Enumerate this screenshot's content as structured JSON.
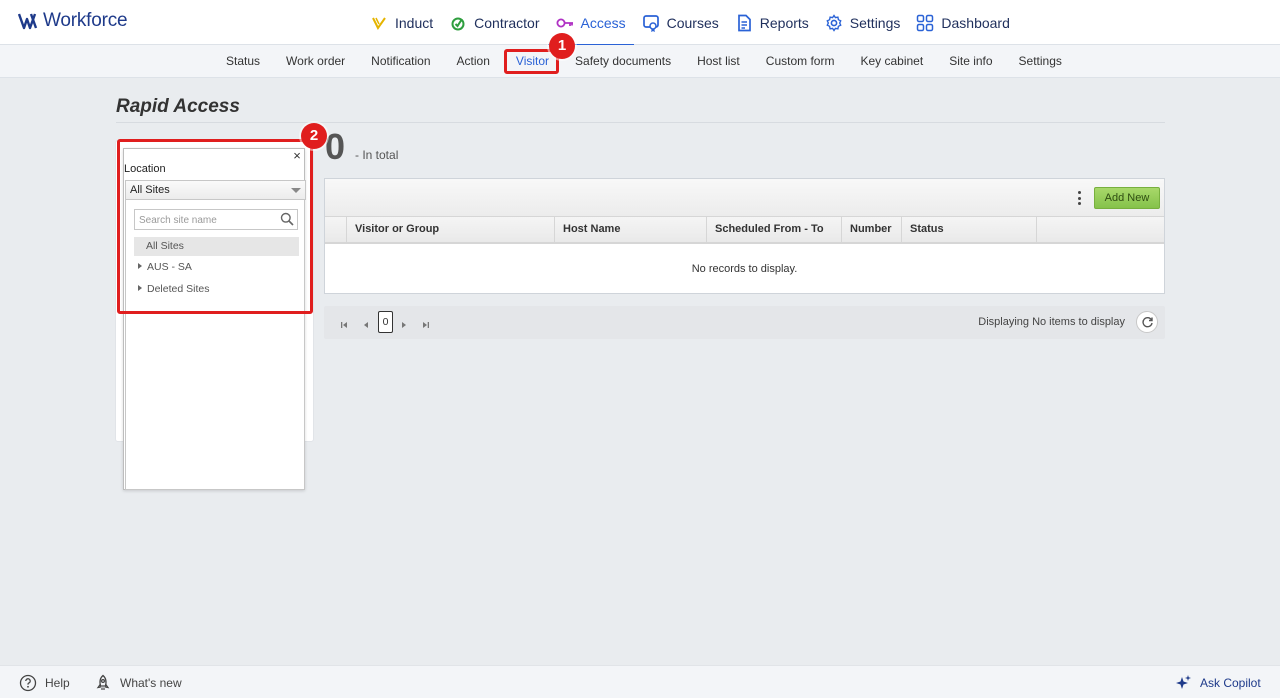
{
  "brand": {
    "name": "Workforce"
  },
  "main_nav": [
    {
      "label": "Induct",
      "icon": "induct-icon",
      "active": false
    },
    {
      "label": "Contractor",
      "icon": "contractor-icon",
      "active": false
    },
    {
      "label": "Access",
      "icon": "key-icon",
      "active": true
    },
    {
      "label": "Courses",
      "icon": "courses-icon",
      "active": false
    },
    {
      "label": "Reports",
      "icon": "reports-icon",
      "active": false
    },
    {
      "label": "Settings",
      "icon": "gear-icon",
      "active": false
    },
    {
      "label": "Dashboard",
      "icon": "grid-icon",
      "active": false
    }
  ],
  "sub_nav": [
    {
      "label": "Status"
    },
    {
      "label": "Work order"
    },
    {
      "label": "Notification"
    },
    {
      "label": "Action"
    },
    {
      "label": "Visitor",
      "active": true
    },
    {
      "label": "Safety documents"
    },
    {
      "label": "Host list"
    },
    {
      "label": "Custom form"
    },
    {
      "label": "Key cabinet"
    },
    {
      "label": "Site info"
    },
    {
      "label": "Settings"
    }
  ],
  "annotations": {
    "step1": "1",
    "step2": "2"
  },
  "page": {
    "title": "Rapid Access"
  },
  "filter": {
    "close": "×",
    "location_label": "Location",
    "selected": "All Sites",
    "search_placeholder": "Search site name",
    "tree": [
      {
        "label": "All Sites",
        "selected": true,
        "expandable": false
      },
      {
        "label": "AUS - SA",
        "selected": false,
        "expandable": true
      },
      {
        "label": "Deleted Sites",
        "selected": false,
        "expandable": true
      }
    ]
  },
  "summary": {
    "count": "0",
    "text": "-  In total"
  },
  "grid": {
    "add_new": "Add New",
    "columns": [
      "Visitor or Group",
      "Host Name",
      "Scheduled From - To",
      "Number",
      "Status"
    ],
    "empty_message": "No records to display."
  },
  "pager": {
    "page": "0",
    "status": "Displaying No items to display"
  },
  "footer": {
    "help": "Help",
    "whats_new": "What's new",
    "copilot": "Ask Copilot"
  },
  "colors": {
    "accent": "#2a62d6",
    "brand": "#1e3a8a",
    "annotation": "#e01e1e",
    "add_button": "#8cc652"
  }
}
